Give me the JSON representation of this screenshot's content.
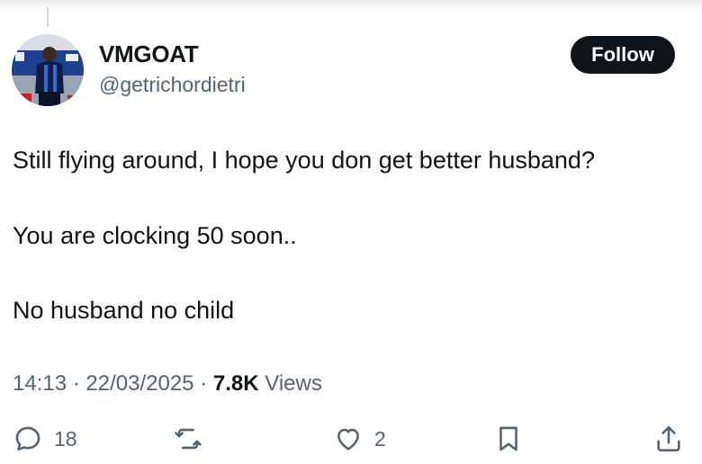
{
  "author": {
    "display_name": "VMGOAT",
    "handle": "@getrichordietri"
  },
  "follow_label": "Follow",
  "tweet": {
    "lines": [
      "Still flying around, I hope you don get better husband?",
      "You are clocking 50 soon..",
      "No husband no child"
    ]
  },
  "meta": {
    "time": "14:13",
    "date": "22/03/2025",
    "separator": "·",
    "views_count": "7.8K",
    "views_label": "Views"
  },
  "actions": {
    "replies": "18",
    "likes": "2"
  },
  "icons": [
    "reply-icon",
    "repost-icon",
    "like-icon",
    "bookmark-icon",
    "share-icon"
  ],
  "colors": {
    "text": "#0f1419",
    "secondary": "#536471",
    "button_bg": "#0f1419",
    "background": "#ffffff"
  }
}
